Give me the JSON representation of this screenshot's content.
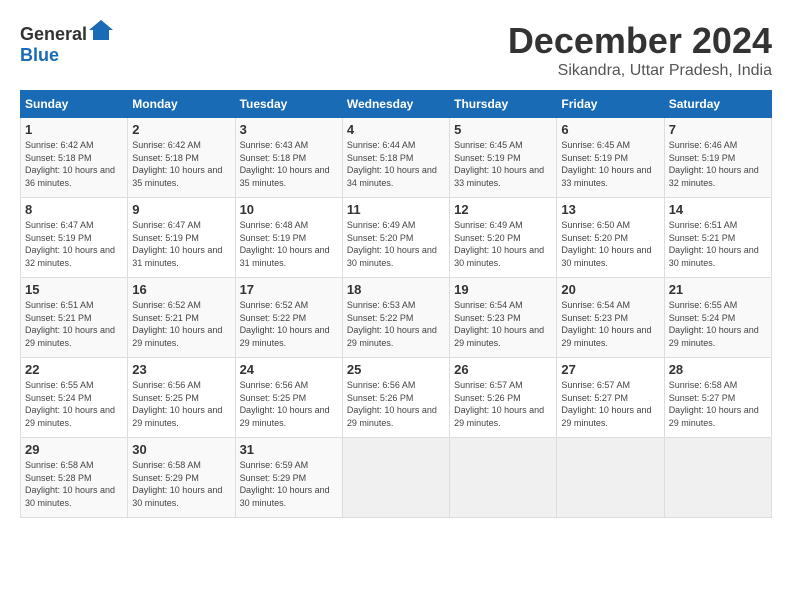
{
  "logo": {
    "general": "General",
    "blue": "Blue"
  },
  "title": {
    "month": "December 2024",
    "location": "Sikandra, Uttar Pradesh, India"
  },
  "weekdays": [
    "Sunday",
    "Monday",
    "Tuesday",
    "Wednesday",
    "Thursday",
    "Friday",
    "Saturday"
  ],
  "weeks": [
    [
      {
        "day": "1",
        "sunrise": "6:42 AM",
        "sunset": "5:18 PM",
        "daylight": "10 hours and 36 minutes."
      },
      {
        "day": "2",
        "sunrise": "6:42 AM",
        "sunset": "5:18 PM",
        "daylight": "10 hours and 35 minutes."
      },
      {
        "day": "3",
        "sunrise": "6:43 AM",
        "sunset": "5:18 PM",
        "daylight": "10 hours and 35 minutes."
      },
      {
        "day": "4",
        "sunrise": "6:44 AM",
        "sunset": "5:18 PM",
        "daylight": "10 hours and 34 minutes."
      },
      {
        "day": "5",
        "sunrise": "6:45 AM",
        "sunset": "5:19 PM",
        "daylight": "10 hours and 33 minutes."
      },
      {
        "day": "6",
        "sunrise": "6:45 AM",
        "sunset": "5:19 PM",
        "daylight": "10 hours and 33 minutes."
      },
      {
        "day": "7",
        "sunrise": "6:46 AM",
        "sunset": "5:19 PM",
        "daylight": "10 hours and 32 minutes."
      }
    ],
    [
      {
        "day": "8",
        "sunrise": "6:47 AM",
        "sunset": "5:19 PM",
        "daylight": "10 hours and 32 minutes."
      },
      {
        "day": "9",
        "sunrise": "6:47 AM",
        "sunset": "5:19 PM",
        "daylight": "10 hours and 31 minutes."
      },
      {
        "day": "10",
        "sunrise": "6:48 AM",
        "sunset": "5:19 PM",
        "daylight": "10 hours and 31 minutes."
      },
      {
        "day": "11",
        "sunrise": "6:49 AM",
        "sunset": "5:20 PM",
        "daylight": "10 hours and 30 minutes."
      },
      {
        "day": "12",
        "sunrise": "6:49 AM",
        "sunset": "5:20 PM",
        "daylight": "10 hours and 30 minutes."
      },
      {
        "day": "13",
        "sunrise": "6:50 AM",
        "sunset": "5:20 PM",
        "daylight": "10 hours and 30 minutes."
      },
      {
        "day": "14",
        "sunrise": "6:51 AM",
        "sunset": "5:21 PM",
        "daylight": "10 hours and 30 minutes."
      }
    ],
    [
      {
        "day": "15",
        "sunrise": "6:51 AM",
        "sunset": "5:21 PM",
        "daylight": "10 hours and 29 minutes."
      },
      {
        "day": "16",
        "sunrise": "6:52 AM",
        "sunset": "5:21 PM",
        "daylight": "10 hours and 29 minutes."
      },
      {
        "day": "17",
        "sunrise": "6:52 AM",
        "sunset": "5:22 PM",
        "daylight": "10 hours and 29 minutes."
      },
      {
        "day": "18",
        "sunrise": "6:53 AM",
        "sunset": "5:22 PM",
        "daylight": "10 hours and 29 minutes."
      },
      {
        "day": "19",
        "sunrise": "6:54 AM",
        "sunset": "5:23 PM",
        "daylight": "10 hours and 29 minutes."
      },
      {
        "day": "20",
        "sunrise": "6:54 AM",
        "sunset": "5:23 PM",
        "daylight": "10 hours and 29 minutes."
      },
      {
        "day": "21",
        "sunrise": "6:55 AM",
        "sunset": "5:24 PM",
        "daylight": "10 hours and 29 minutes."
      }
    ],
    [
      {
        "day": "22",
        "sunrise": "6:55 AM",
        "sunset": "5:24 PM",
        "daylight": "10 hours and 29 minutes."
      },
      {
        "day": "23",
        "sunrise": "6:56 AM",
        "sunset": "5:25 PM",
        "daylight": "10 hours and 29 minutes."
      },
      {
        "day": "24",
        "sunrise": "6:56 AM",
        "sunset": "5:25 PM",
        "daylight": "10 hours and 29 minutes."
      },
      {
        "day": "25",
        "sunrise": "6:56 AM",
        "sunset": "5:26 PM",
        "daylight": "10 hours and 29 minutes."
      },
      {
        "day": "26",
        "sunrise": "6:57 AM",
        "sunset": "5:26 PM",
        "daylight": "10 hours and 29 minutes."
      },
      {
        "day": "27",
        "sunrise": "6:57 AM",
        "sunset": "5:27 PM",
        "daylight": "10 hours and 29 minutes."
      },
      {
        "day": "28",
        "sunrise": "6:58 AM",
        "sunset": "5:27 PM",
        "daylight": "10 hours and 29 minutes."
      }
    ],
    [
      {
        "day": "29",
        "sunrise": "6:58 AM",
        "sunset": "5:28 PM",
        "daylight": "10 hours and 30 minutes."
      },
      {
        "day": "30",
        "sunrise": "6:58 AM",
        "sunset": "5:29 PM",
        "daylight": "10 hours and 30 minutes."
      },
      {
        "day": "31",
        "sunrise": "6:59 AM",
        "sunset": "5:29 PM",
        "daylight": "10 hours and 30 minutes."
      },
      null,
      null,
      null,
      null
    ]
  ]
}
